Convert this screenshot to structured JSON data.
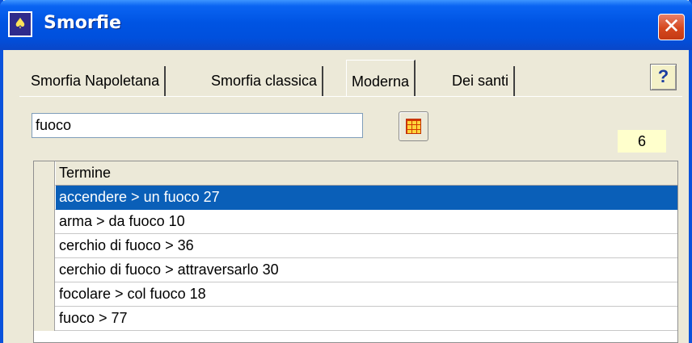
{
  "window": {
    "title": "Smorfie",
    "close_label": "✕"
  },
  "tabs": [
    {
      "label": "Smorfia Napoletana",
      "active": false
    },
    {
      "label": "Smorfia classica",
      "active": false
    },
    {
      "label": "Moderna",
      "active": true
    },
    {
      "label": "Dei santi",
      "active": false
    }
  ],
  "help": {
    "label": "?"
  },
  "search": {
    "value": "fuoco"
  },
  "result_count": "6",
  "table": {
    "header": "Termine",
    "rows": [
      {
        "text": "accendere > un fuoco 27",
        "selected": true
      },
      {
        "text": "arma > da fuoco 10",
        "selected": false
      },
      {
        "text": "cerchio di fuoco > 36",
        "selected": false
      },
      {
        "text": "cerchio di fuoco > attraversarlo 30",
        "selected": false
      },
      {
        "text": "focolare > col fuoco 18",
        "selected": false
      },
      {
        "text": "fuoco > 77",
        "selected": false
      }
    ]
  },
  "colors": {
    "titlebar": "#0054e3",
    "selection": "#0a5fb8",
    "badge": "#ffffcc"
  }
}
